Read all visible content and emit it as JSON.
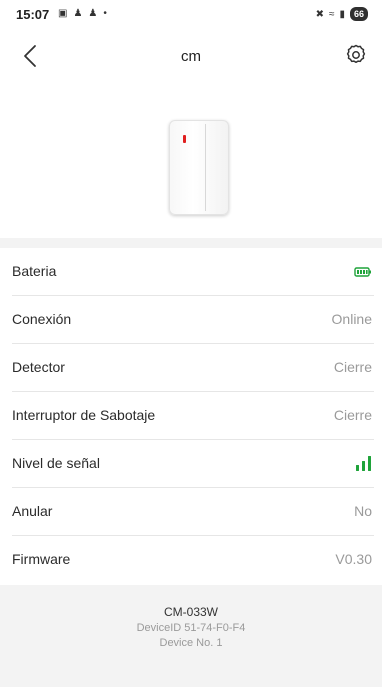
{
  "status_bar": {
    "time": "15:07",
    "left_icons": [
      "notification-icon",
      "app-icon",
      "app-icon",
      "dot-icon"
    ],
    "battery": "66"
  },
  "header": {
    "title": "cm"
  },
  "rows": [
    {
      "label": "Bateria",
      "value": "",
      "indicator": "battery-icon"
    },
    {
      "label": "Conexión",
      "value": "Online"
    },
    {
      "label": "Detector",
      "value": "Cierre"
    },
    {
      "label": "Interruptor de Sabotaje",
      "value": "Cierre"
    },
    {
      "label": "Nivel de señal",
      "value": "",
      "indicator": "signal-strength-icon"
    },
    {
      "label": "Anular",
      "value": "No"
    },
    {
      "label": "Firmware",
      "value": "V0.30"
    }
  ],
  "footer": {
    "model": "CM-033W",
    "device_id": "DeviceID 51-74-F0-F4",
    "device_no": "Device No. 1"
  },
  "colors": {
    "accent_green": "#1fa33a",
    "led_red": "#e02020",
    "muted_text": "#9a9a9a",
    "band_bg": "#f3f3f3"
  }
}
